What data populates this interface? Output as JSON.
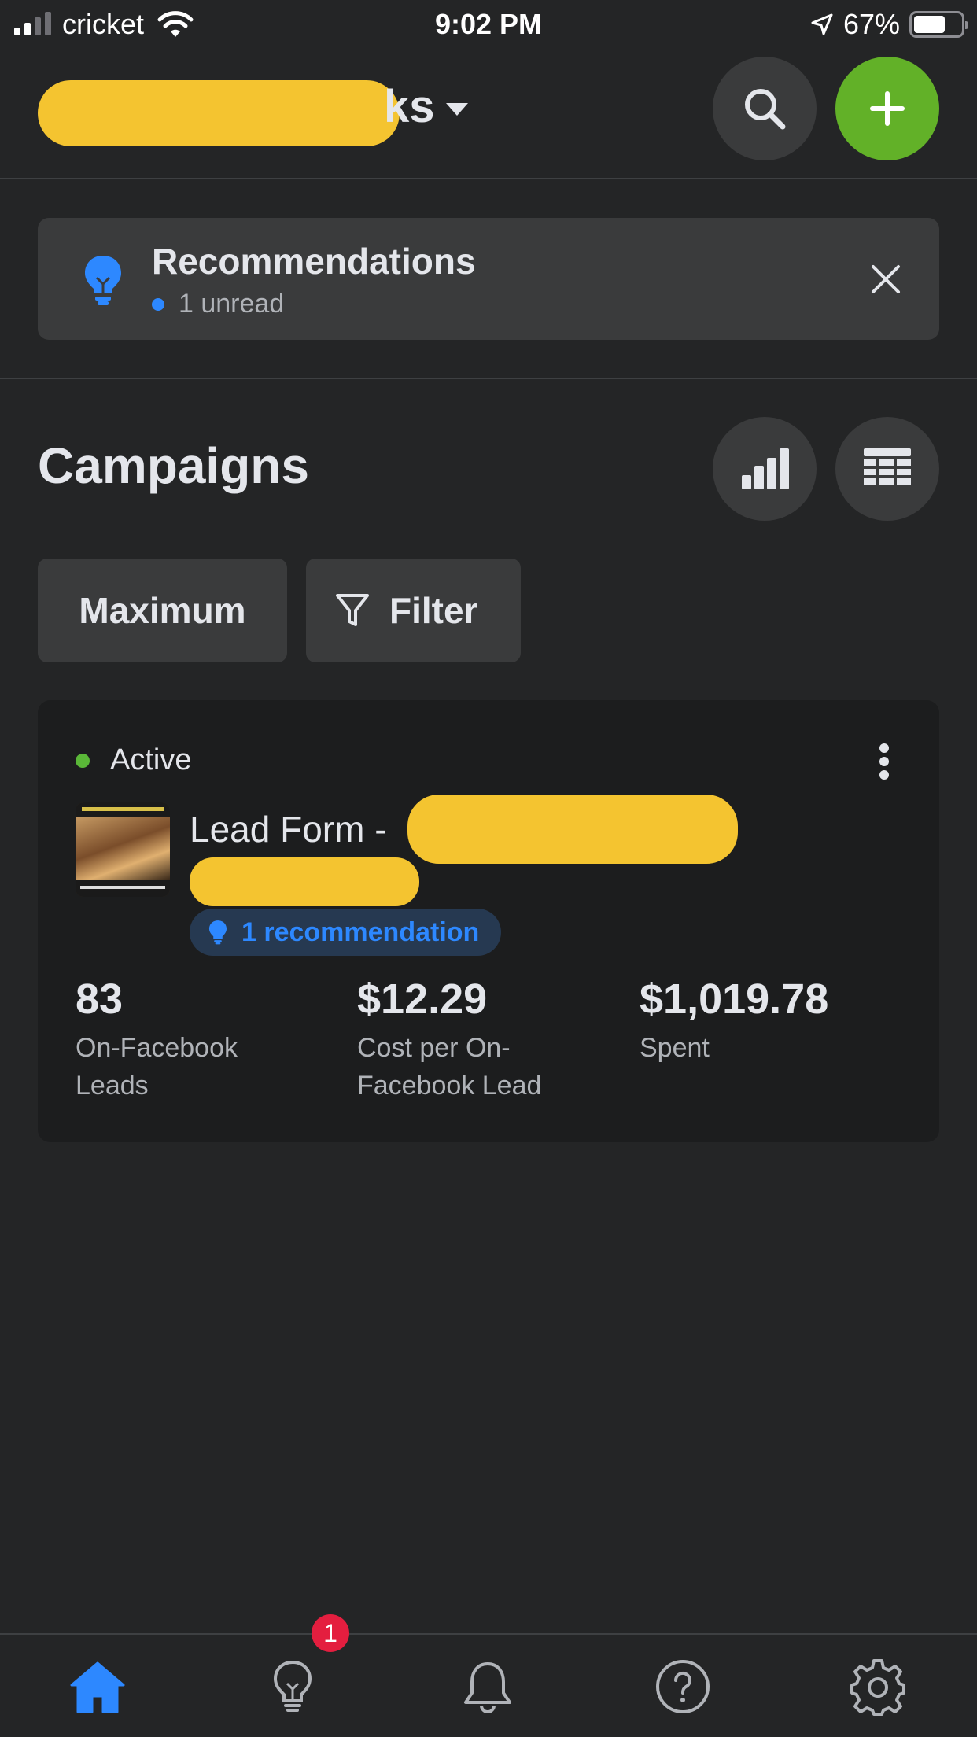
{
  "status_bar": {
    "carrier": "cricket",
    "time": "9:02 PM",
    "battery_percent": "67%",
    "battery_level": 0.67,
    "icons": [
      "signal-icon",
      "wifi-icon",
      "location-arrow-icon",
      "battery-icon"
    ]
  },
  "header": {
    "account_name_visible": "ks",
    "icons": [
      "chevron-down-icon",
      "search-icon",
      "plus-icon"
    ]
  },
  "recommendations_banner": {
    "title": "Recommendations",
    "unread": "1 unread",
    "icons": [
      "lightbulb-icon",
      "close-icon"
    ]
  },
  "campaigns": {
    "title": "Campaigns",
    "date_range": "Maximum",
    "filter_label": "Filter",
    "icons": [
      "bar-chart-icon",
      "table-icon",
      "filter-icon"
    ]
  },
  "campaign_card": {
    "status": "Active",
    "name_prefix": "Lead Form -",
    "recommendation": "1 recommendation",
    "metrics": [
      {
        "value": "83",
        "label": "On-Facebook Leads"
      },
      {
        "value": "$12.29",
        "label": "Cost per On-Facebook Lead"
      },
      {
        "value": "$1,019.78",
        "label": "Spent"
      }
    ]
  },
  "tab_bar": {
    "icons": [
      "home-icon",
      "lightbulb-icon",
      "bell-icon",
      "help-icon",
      "gear-icon"
    ],
    "ideas_badge": "1"
  },
  "colors": {
    "background": "#242526",
    "surface": "#3a3b3c",
    "card": "#1c1d1e",
    "accent_blue": "#2d88ff",
    "create_green": "#62b128",
    "active_green": "#5ab738",
    "badge_red": "#e41e3f",
    "redaction_yellow": "#f4c430"
  }
}
